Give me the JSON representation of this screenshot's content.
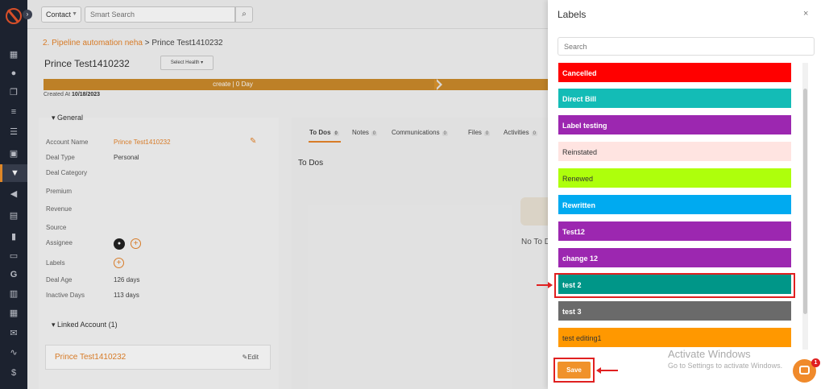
{
  "sidebar": {
    "icons": [
      "logo-icon",
      "dashboard-icon",
      "contacts-icon",
      "copy-icon",
      "list-icon",
      "user-card-icon",
      "pipeline-icon",
      "megaphone-icon",
      "document-icon",
      "chart-icon",
      "folder-icon",
      "google-icon",
      "table-icon",
      "calendar-icon",
      "mail-icon",
      "signature-icon",
      "dollar-icon"
    ],
    "toggle_glyph": "›"
  },
  "topbar": {
    "contact_select": "Contact",
    "search_placeholder": "Smart Search"
  },
  "breadcrumb": {
    "link": "2. Pipeline automation neha",
    "separator": ">",
    "current": "Prince Test1410232"
  },
  "deal": {
    "title": "Prince Test1410232",
    "health_button": "Select Health",
    "stage_label": "create | 0 Day",
    "created_label": "Created At",
    "created_date": "10/18/2023"
  },
  "general": {
    "heading": "General",
    "fields": [
      {
        "label": "Account Name",
        "value": "Prince Test1410232"
      },
      {
        "label": "Deal Type",
        "value": "Personal"
      },
      {
        "label": "Deal Category",
        "value": ""
      },
      {
        "label": "Premium",
        "value": ""
      },
      {
        "label": "Revenue",
        "value": ""
      },
      {
        "label": "Source",
        "value": ""
      },
      {
        "label": "Assignee",
        "value": ""
      },
      {
        "label": "Labels",
        "value": ""
      },
      {
        "label": "Deal Age",
        "value": "126 days"
      },
      {
        "label": "Inactive Days",
        "value": "113 days"
      }
    ]
  },
  "linked": {
    "heading": "Linked Account (1)",
    "account_name": "Prince Test1410232",
    "edit_label": "Edit"
  },
  "tabs": [
    {
      "label": "To Dos",
      "count": "0"
    },
    {
      "label": "Notes",
      "count": "0"
    },
    {
      "label": "Communications",
      "count": "0"
    },
    {
      "label": "Files",
      "count": "0"
    },
    {
      "label": "Activities",
      "count": "0"
    }
  ],
  "todos": {
    "title": "To Dos",
    "empty_text": "No To D"
  },
  "labels_drawer": {
    "title": "Labels",
    "close_glyph": "×",
    "search_placeholder": "Search",
    "items": [
      {
        "name": "Cancelled",
        "color": "#ff0000"
      },
      {
        "name": "Direct Bill",
        "color": "#13bcb6"
      },
      {
        "name": "Label testing",
        "color": "#9c27b0"
      },
      {
        "name": "Reinstated",
        "color": "#ffe4e1"
      },
      {
        "name": "Renewed",
        "color": "#aeff0c"
      },
      {
        "name": "Rewritten",
        "color": "#00aaf0"
      },
      {
        "name": "Test12",
        "color": "#9c27b0"
      },
      {
        "name": "change 12",
        "color": "#9c27b0"
      },
      {
        "name": "test 2",
        "color": "#009688"
      },
      {
        "name": "test 3",
        "color": "#6a6a6a"
      },
      {
        "name": "test editing1",
        "color": "#ff9800"
      }
    ],
    "save_label": "Save"
  },
  "watermark": {
    "title": "Activate Windows",
    "subtitle": "Go to Settings to activate Windows."
  },
  "chat": {
    "badge_count": "1"
  }
}
